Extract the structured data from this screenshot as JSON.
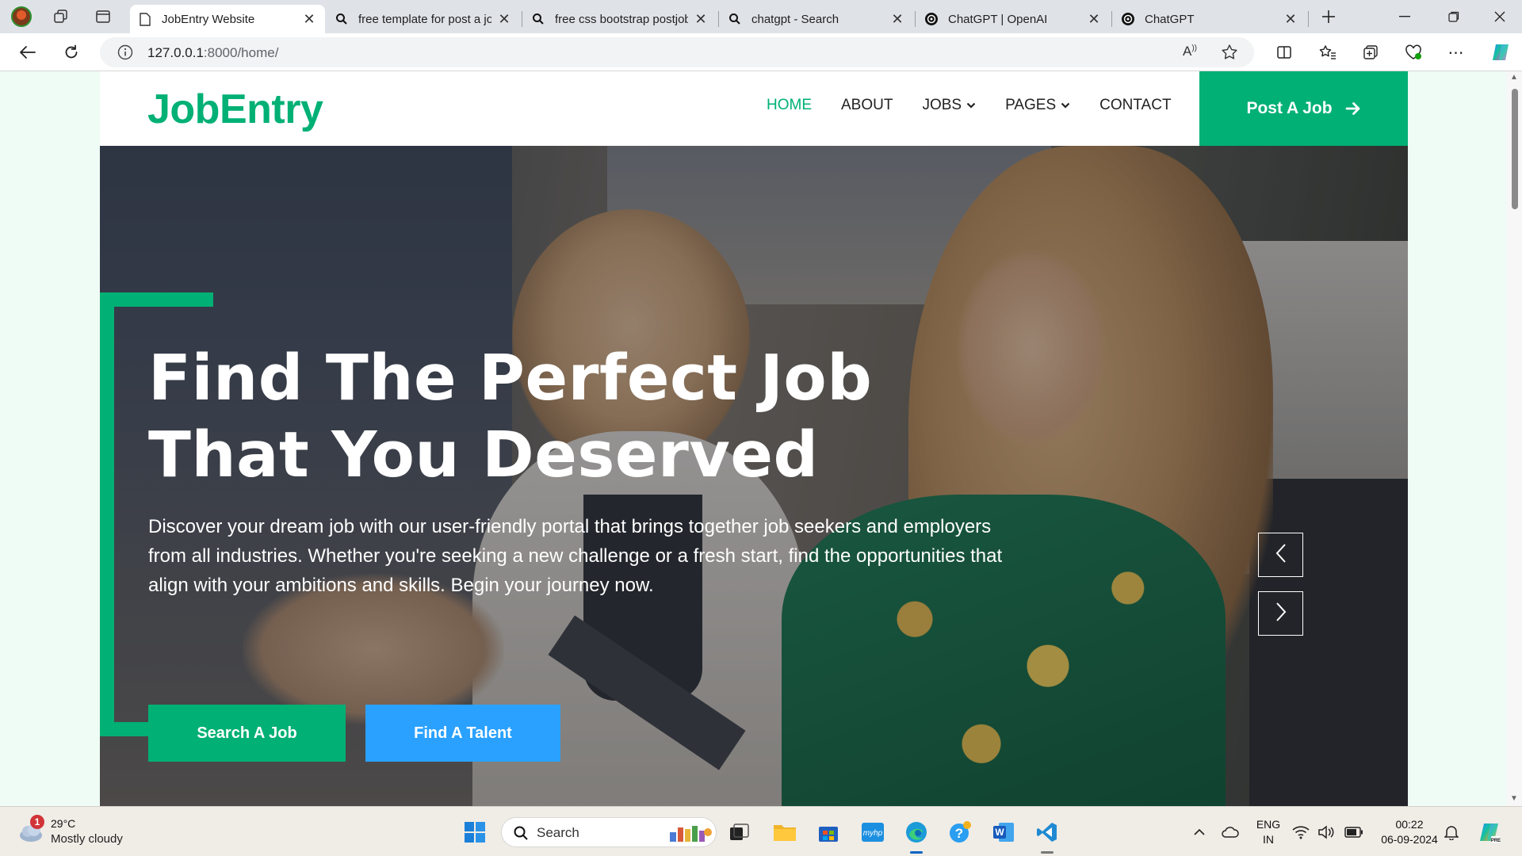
{
  "browser": {
    "tabs": [
      {
        "title": "JobEntry Website",
        "icon": "page-icon",
        "active": true
      },
      {
        "title": "free template for post a jo",
        "icon": "search-icon",
        "active": false
      },
      {
        "title": "free css bootstrap postjob",
        "icon": "search-icon",
        "active": false
      },
      {
        "title": "chatgpt - Search",
        "icon": "search-icon",
        "active": false
      },
      {
        "title": "ChatGPT | OpenAI",
        "icon": "openai-icon",
        "active": false
      },
      {
        "title": "ChatGPT",
        "icon": "openai-icon",
        "active": false
      }
    ],
    "url_host": "127.0.0.1",
    "url_path": ":8000/home/"
  },
  "site": {
    "brand": "JobEntry",
    "nav": {
      "home": "HOME",
      "about": "ABOUT",
      "jobs": "JOBS",
      "pages": "PAGES",
      "contact": "CONTACT"
    },
    "post_job": "Post A Job",
    "hero": {
      "title_line1": "Find The Perfect Job",
      "title_line2": "That You Deserved",
      "text": "Discover your dream job with our user-friendly portal that brings together job seekers and employers from all industries. Whether you're seeking a new challenge or a fresh start, find the opportunities that align with your ambitions and skills. Begin your journey now.",
      "search_button": "Search A Job",
      "talent_button": "Find A Talent"
    },
    "colors": {
      "primary": "#00b074",
      "secondary": "#2aa1ff"
    }
  },
  "taskbar": {
    "weather": {
      "badge": "1",
      "temp": "29°C",
      "condition": "Mostly cloudy"
    },
    "search": "Search",
    "lang": {
      "line1": "ENG",
      "line2": "IN"
    },
    "clock": {
      "time": "00:22",
      "date": "06-09-2024"
    }
  }
}
